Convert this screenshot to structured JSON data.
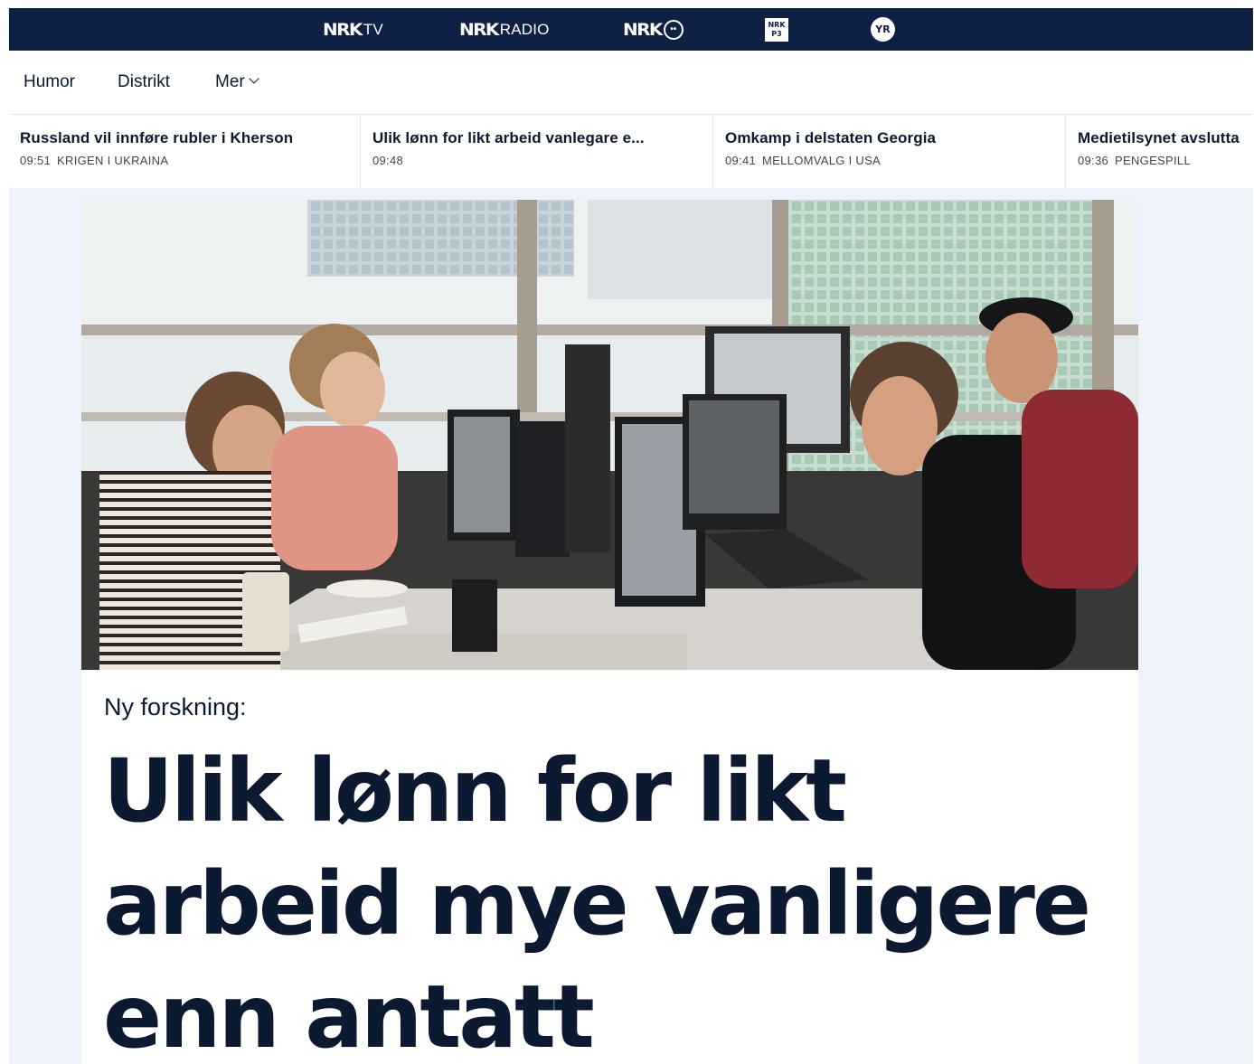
{
  "topbar": {
    "brands": [
      {
        "logo": "NRK",
        "suffix": "TV",
        "icon": "nrk-tv-logo"
      },
      {
        "logo": "NRK",
        "suffix": "RADIO",
        "icon": "nrk-radio-logo"
      },
      {
        "logo": "NRK",
        "suffix": "",
        "icon": "nrk-super-logo"
      },
      {
        "logo": "NRK P3",
        "suffix": "",
        "icon": "nrk-p3-logo"
      },
      {
        "logo": "YR",
        "suffix": "",
        "icon": "yr-logo"
      }
    ],
    "background": "#0e2044"
  },
  "subnav": {
    "items": [
      "Humor",
      "Distrikt",
      "Mer"
    ]
  },
  "ticker": [
    {
      "title": "Russland vil innføre rubler i Kherson",
      "time": "09:51",
      "category": "KRIGEN I UKRAINA"
    },
    {
      "title": "Ulik lønn for likt arbeid vanlegare e...",
      "time": "09:48",
      "category": ""
    },
    {
      "title": "Omkamp i delstaten Georgia",
      "time": "09:41",
      "category": "MELLOMVALG I USA"
    },
    {
      "title": "Medietilsynet avslutta",
      "time": "09:36",
      "category": "PENGESPILL"
    }
  ],
  "article": {
    "kicker": "Ny forskning:",
    "headline": "Ulik lønn for likt arbeid mye vanligere enn antatt",
    "image": "office-workers-photo"
  },
  "colors": {
    "text": "#0b1931",
    "page_bg": "#eef3fb",
    "nav_bg": "#0e2044"
  }
}
